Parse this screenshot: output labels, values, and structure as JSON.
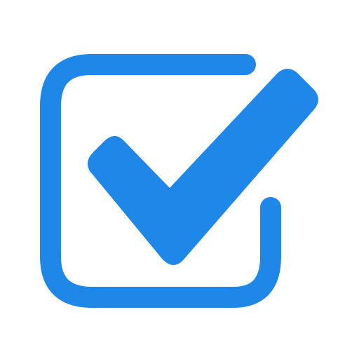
{
  "icon": {
    "name": "checkbox-checked-icon",
    "color": "#1f87e8",
    "background": "#ffffff"
  }
}
